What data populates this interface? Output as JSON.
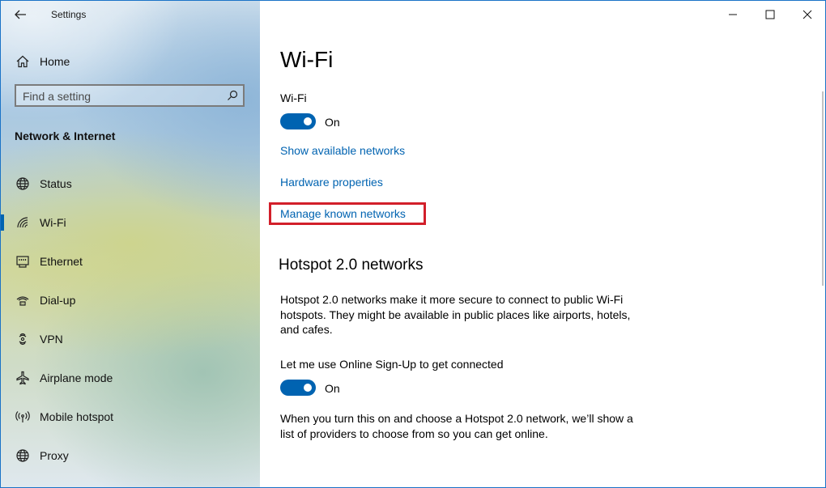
{
  "window": {
    "title": "Settings",
    "accent": "#0063b1",
    "highlight_color": "#d21f2a"
  },
  "sidebar": {
    "back_icon": "arrow-left-icon",
    "home_label": "Home",
    "search_placeholder": "Find a setting",
    "section_title": "Network & Internet",
    "items": [
      {
        "label": "Status",
        "icon": "globe-icon",
        "active": false
      },
      {
        "label": "Wi-Fi",
        "icon": "wifi-icon",
        "active": true
      },
      {
        "label": "Ethernet",
        "icon": "ethernet-icon",
        "active": false
      },
      {
        "label": "Dial-up",
        "icon": "dialup-icon",
        "active": false
      },
      {
        "label": "VPN",
        "icon": "vpn-icon",
        "active": false
      },
      {
        "label": "Airplane mode",
        "icon": "airplane-icon",
        "active": false
      },
      {
        "label": "Mobile hotspot",
        "icon": "hotspot-icon",
        "active": false
      },
      {
        "label": "Proxy",
        "icon": "globe-icon",
        "active": false
      }
    ]
  },
  "main": {
    "title": "Wi-Fi",
    "wifi_label": "Wi-Fi",
    "wifi_toggle_state": "On",
    "links": {
      "show_networks": "Show available networks",
      "hardware": "Hardware properties",
      "manage_known": "Manage known networks"
    },
    "hotspot": {
      "heading": "Hotspot 2.0 networks",
      "description": "Hotspot 2.0 networks make it more secure to connect to public Wi-Fi hotspots. They might be available in public places like airports, hotels, and cafes.",
      "signup_label": "Let me use Online Sign-Up to get connected",
      "signup_toggle_state": "On",
      "signup_description": "When you turn this on and choose a Hotspot 2.0 network, we’ll show a list of providers to choose from so you can get online."
    }
  }
}
